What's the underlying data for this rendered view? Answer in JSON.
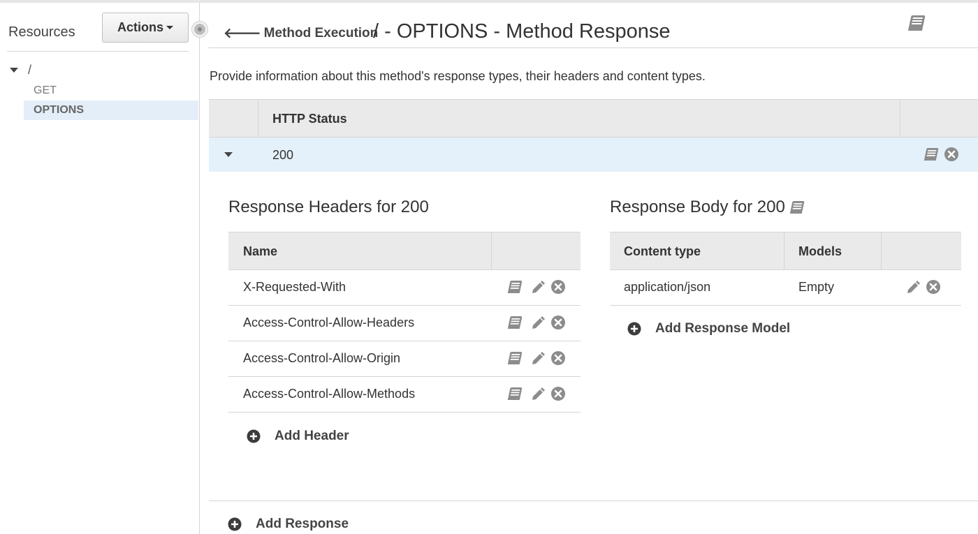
{
  "sidebar": {
    "title": "Resources",
    "actions_label": "Actions",
    "tree": {
      "root": "/",
      "items": [
        {
          "label": "GET",
          "selected": false
        },
        {
          "label": "OPTIONS",
          "selected": true
        }
      ]
    }
  },
  "header": {
    "back_label": "Method Execution",
    "title": "/ - OPTIONS - Method Response"
  },
  "main": {
    "description": "Provide information about this method's response types, their headers and content types.",
    "status_table": {
      "column_header": "HTTP Status",
      "rows": [
        {
          "code": "200",
          "expanded": true
        }
      ]
    },
    "response_headers": {
      "title": "Response Headers for 200",
      "column_header": "Name",
      "rows": [
        {
          "name": "X-Requested-With"
        },
        {
          "name": "Access-Control-Allow-Headers"
        },
        {
          "name": "Access-Control-Allow-Origin"
        },
        {
          "name": "Access-Control-Allow-Methods"
        }
      ],
      "add_label": "Add Header"
    },
    "response_body": {
      "title": "Response Body for 200",
      "columns": [
        "Content type",
        "Models"
      ],
      "rows": [
        {
          "content_type": "application/json",
          "model": "Empty"
        }
      ],
      "add_label": "Add Response Model"
    },
    "add_response_label": "Add Response"
  },
  "icons": [
    "book-icon",
    "pencil-icon",
    "delete-icon",
    "add-icon",
    "arrow-left-icon",
    "caret-down-icon",
    "collapse-handle-icon"
  ],
  "colors": {
    "selected_row_bg": "#e4f1fb",
    "selected_tree_bg": "#e4eef8",
    "table_header_bg": "#eaeaea",
    "icon_gray": "#8c8c8c",
    "add_icon": "#3c3c3c"
  }
}
